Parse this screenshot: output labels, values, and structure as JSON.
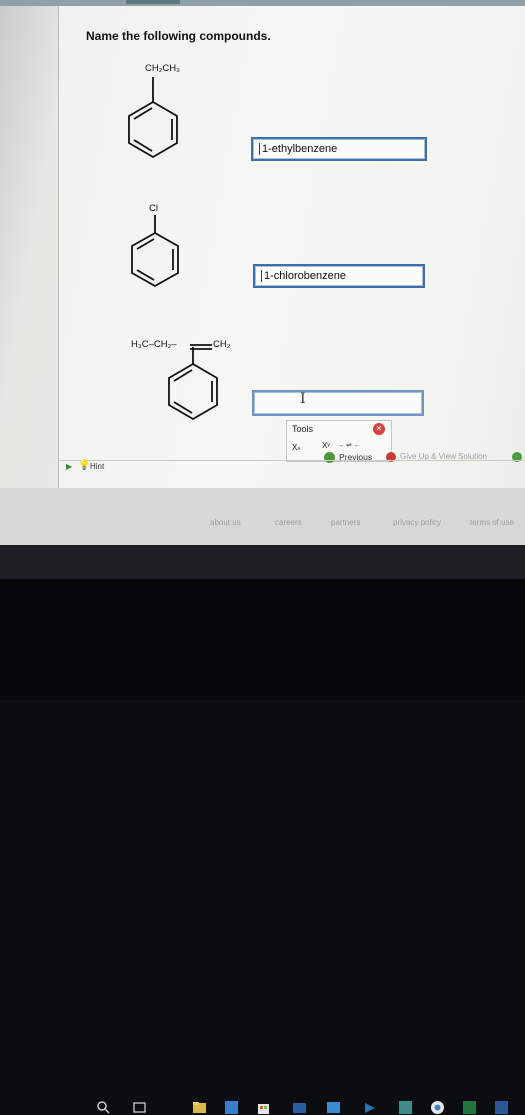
{
  "question": {
    "title": "Name the following compounds."
  },
  "compounds": [
    {
      "substituent_label": "CH₂CH₃",
      "answer": "1-ethylbenzene"
    },
    {
      "substituent_label": "Cl",
      "answer": "1-chlorobenzene"
    },
    {
      "substituent_label_left": "H₃C–CH₂–",
      "substituent_label_right": "CH₂",
      "answer": ""
    }
  ],
  "tools": {
    "label": "Tools",
    "subscript_label": "Xₙ",
    "superscript_label": "Xʸ",
    "arrows": "→ ⇌ ←"
  },
  "nav": {
    "previous_label": "Previous",
    "give_up_label": "Give Up & View Solution"
  },
  "hint": {
    "label": "Hint"
  },
  "footer": {
    "links": [
      "about us",
      "careers",
      "partners",
      "privacy policy",
      "terms of use"
    ]
  },
  "taskbar": {
    "icons": [
      "search-icon",
      "task-view-icon",
      "file-explorer-icon",
      "edge-icon",
      "store-icon",
      "mail-icon",
      "photos-icon",
      "media-icon",
      "calculator-icon",
      "chrome-icon",
      "excel-icon",
      "word-icon"
    ]
  },
  "colors": {
    "input_border": "#3f6fa8",
    "previous_green": "#4b9a3c",
    "give_up_red": "#cc3a37",
    "taskbar": "#1d2024"
  }
}
